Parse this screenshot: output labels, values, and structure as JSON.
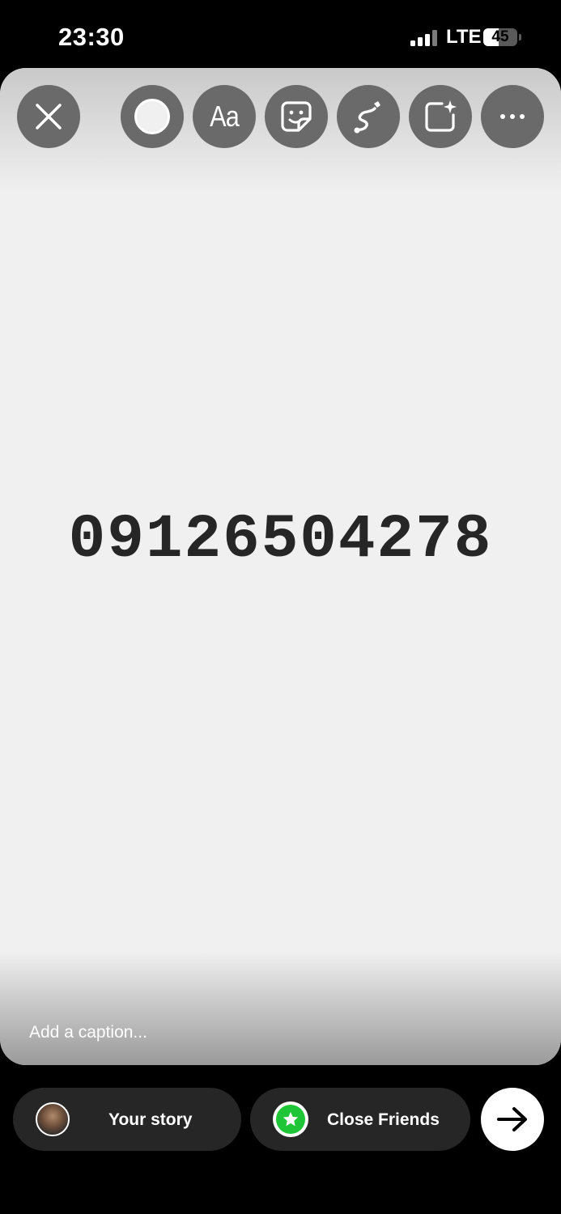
{
  "status_bar": {
    "time": "23:30",
    "network": "LTE",
    "battery_level": "45",
    "battery_fraction": 0.45
  },
  "toolbar": {
    "close_icon": "close-icon",
    "color_icon": "color-circle-icon",
    "text_label": "Aa",
    "sticker_icon": "sticker-icon",
    "draw_icon": "draw-icon",
    "effects_icon": "effects-icon",
    "more_icon": "more-icon"
  },
  "story": {
    "text": "09126504278",
    "background_color": "#f0f0f0",
    "text_color": "#262626"
  },
  "caption": {
    "placeholder": "Add a caption..."
  },
  "share": {
    "your_story_label": "Your story",
    "close_friends_label": "Close Friends",
    "close_friends_color": "#1ec537",
    "send_icon": "arrow-right-icon"
  }
}
